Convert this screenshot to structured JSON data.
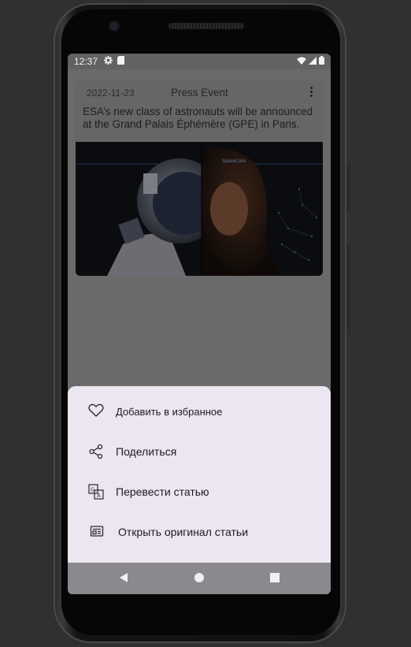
{
  "status_bar": {
    "time": "12:37",
    "icons": [
      "gear-icon",
      "sd-card-icon",
      "wifi-icon",
      "signal-icon",
      "battery-icon"
    ]
  },
  "card": {
    "date": "2022-11-23",
    "category": "Press Event",
    "text": "ESA’s new class of astronauts will be announced at the Grand Palais Éphémère (GPE) in Paris. T…",
    "image_watermark": "SpaceCare"
  },
  "menu": {
    "items": [
      {
        "icon": "heart-icon",
        "label": "Добавить в избранное"
      },
      {
        "icon": "share-icon",
        "label": "Поделиться"
      },
      {
        "icon": "translate-icon",
        "label": "Перевести статью"
      },
      {
        "icon": "newspaper-icon",
        "label": "Открыть оригинал статьи"
      }
    ]
  },
  "nav": {
    "buttons": [
      "back-button",
      "home-button",
      "recents-button"
    ]
  },
  "colors": {
    "sheet_background": "#ece6f1",
    "screen_scrim": "#6a6a6a",
    "nav_bar": "#8b898d"
  }
}
